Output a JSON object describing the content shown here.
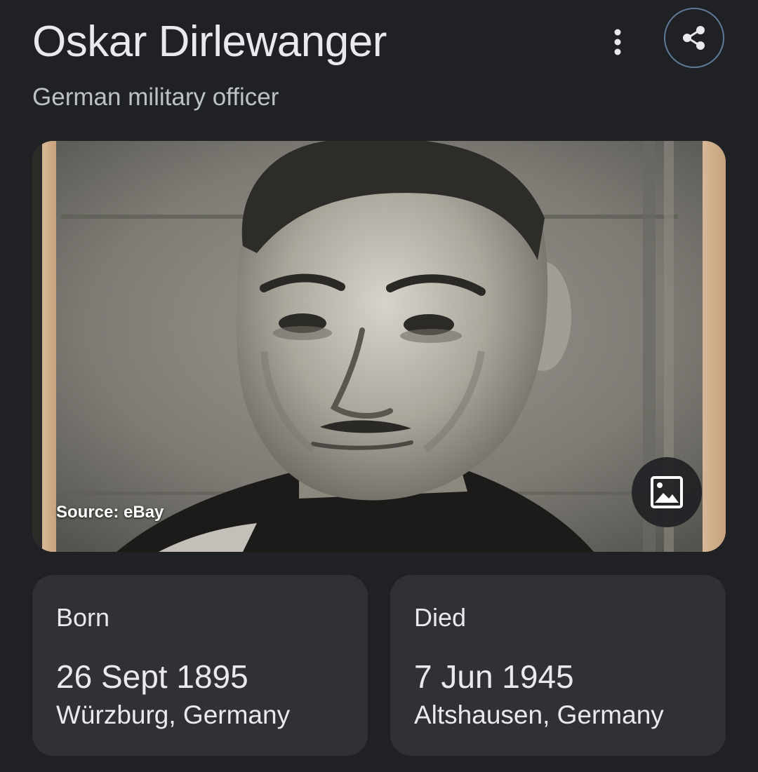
{
  "knowledge_panel": {
    "title": "Oskar Dirlewanger",
    "subtitle": "German military officer",
    "more_icon": "more-vert-icon",
    "share_icon": "share-icon",
    "share_border_color": "#5f7a99"
  },
  "image": {
    "source_label": "Source: eBay",
    "view_images_icon": "image-icon"
  },
  "facts": [
    {
      "label": "Born",
      "date": "26 Sept 1895",
      "place": "Würzburg, Germany"
    },
    {
      "label": "Died",
      "date": "7 Jun 1945",
      "place": "Altshausen, Germany"
    }
  ],
  "colors": {
    "background": "#202124",
    "card": "#303134",
    "text": "#e8eaed",
    "subtle_text": "#bdc1c6"
  }
}
